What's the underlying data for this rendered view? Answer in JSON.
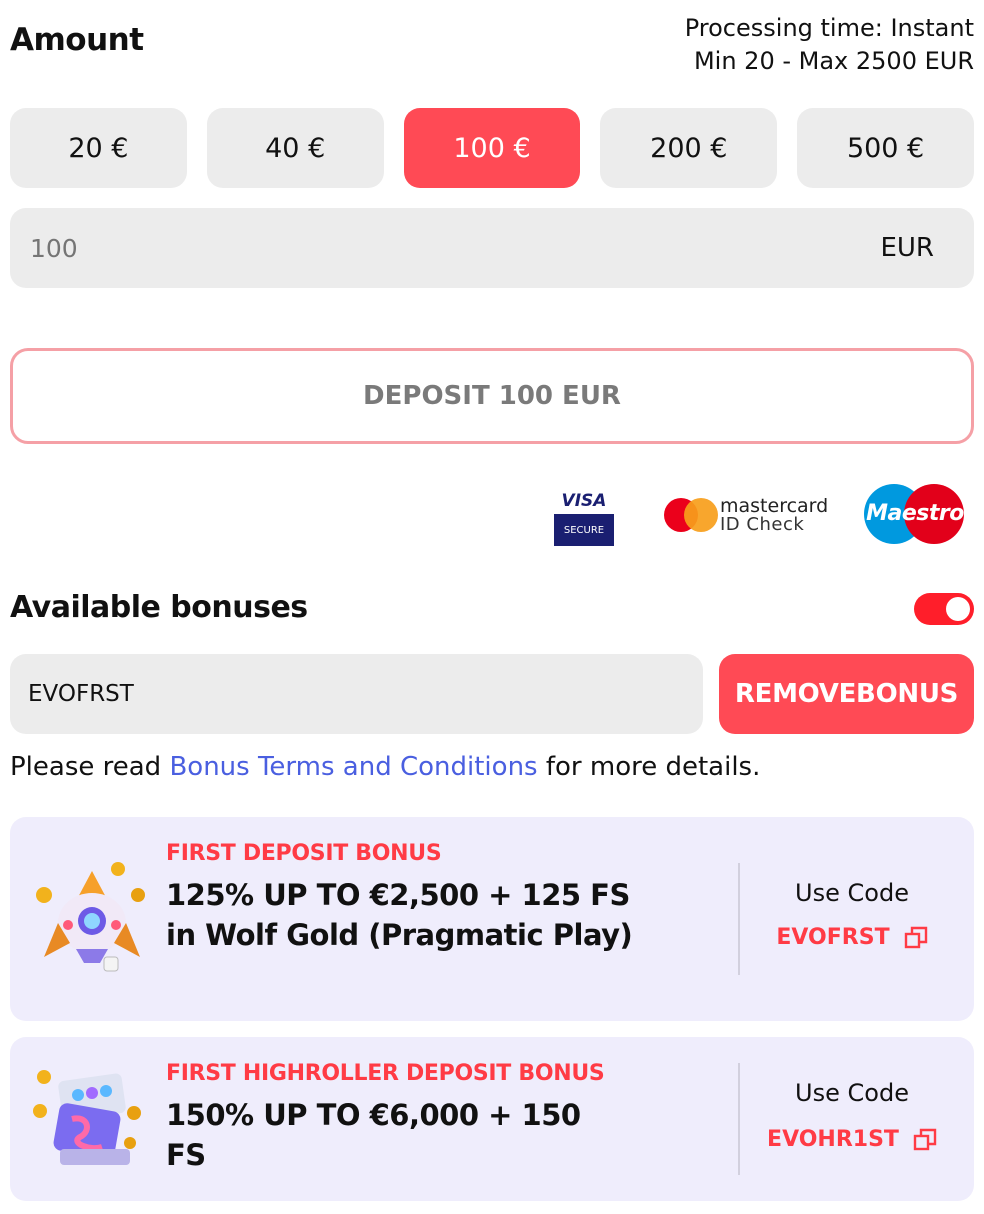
{
  "header": {
    "title": "Amount",
    "processing_time": "Processing time: Instant",
    "limits": "Min 20 - Max 2500 EUR"
  },
  "presets": [
    {
      "label": "20 €"
    },
    {
      "label": "40 €"
    },
    {
      "label": "100 €",
      "selected": true
    },
    {
      "label": "200 €"
    },
    {
      "label": "500 €"
    }
  ],
  "amount_input": {
    "placeholder": "100",
    "currency": "EUR"
  },
  "deposit_button": {
    "label": "DEPOSIT 100 EUR"
  },
  "payment_logos": {
    "visa": {
      "brand": "VISA",
      "sub": "SECURE"
    },
    "mastercard": {
      "line1": "mastercard",
      "line2": "ID Check"
    },
    "maestro": {
      "brand": "Maestro"
    }
  },
  "bonuses": {
    "title": "Available bonuses",
    "toggle_on": true,
    "code_value": "EVOFRST",
    "remove_label": "REMOVEBONUS",
    "terms_prefix": "Please read ",
    "terms_link": "Bonus Terms and Conditions",
    "terms_suffix": " for more details.",
    "cards": [
      {
        "kicker": "FIRST DEPOSIT BONUS",
        "headline": "125% UP TO €2,500 + 125 FS in Wolf Gold (Pragmatic Play)",
        "use_code_label": "Use Code",
        "code": "EVOFRST",
        "art_icon": "rocket-icon"
      },
      {
        "kicker": "FIRST HIGHROLLER DEPOSIT BONUS",
        "headline": "150% UP TO €6,000 + 150 FS",
        "use_code_label": "Use Code",
        "code": "EVOHR1ST",
        "art_icon": "slot-cards-icon"
      }
    ]
  },
  "colors": {
    "accent": "#ff4a55",
    "link": "#4a5fe0",
    "card_bg": "#efedfc",
    "field_bg": "#ececec"
  }
}
